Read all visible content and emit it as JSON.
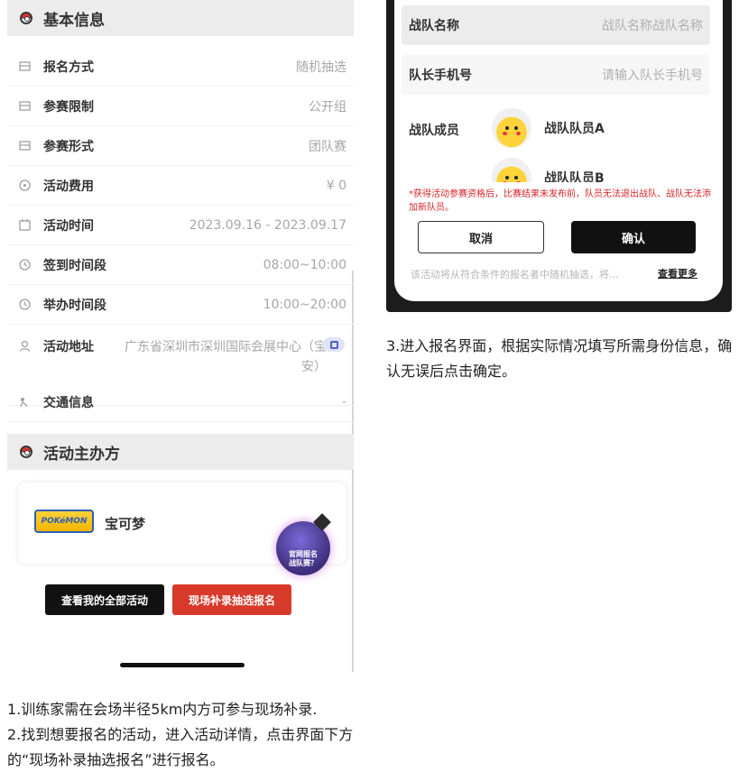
{
  "left_phone": {
    "basic_info": {
      "title": "基本信息",
      "rows": [
        {
          "label": "报名方式",
          "value": "随机抽选",
          "icon": "registration-icon"
        },
        {
          "label": "参赛限制",
          "value": "公开组",
          "icon": "limit-icon"
        },
        {
          "label": "参赛形式",
          "value": "团队赛",
          "icon": "format-icon"
        },
        {
          "label": "活动费用",
          "value": "¥ 0",
          "icon": "fee-icon"
        },
        {
          "label": "活动时间",
          "value": "2023.09.16 - 2023.09.17",
          "icon": "calendar-icon"
        },
        {
          "label": "签到时间段",
          "value": "08:00~10:00",
          "icon": "clock-icon"
        },
        {
          "label": "举办时间段",
          "value": "10:00~20:00",
          "icon": "clock-icon"
        },
        {
          "label": "活动地址",
          "value": "广东省深圳市深圳国际会展中心（宝安）",
          "icon": "location-icon"
        },
        {
          "label": "交通信息",
          "value": "-",
          "icon": "traffic-icon"
        }
      ]
    },
    "organizer": {
      "title": "活动主办方",
      "logo_text": "POKéMON",
      "name": "宝可梦"
    },
    "float_badge": {
      "line1": "官网报名",
      "line2": "战队赛？"
    },
    "buttons": {
      "my_activities": "查看我的全部活动",
      "onsite_register": "现场补录抽选报名"
    }
  },
  "right_phone": {
    "team_name": {
      "label": "战队名称",
      "value": "战队名称战队名称"
    },
    "leader_phone": {
      "label": "队长手机号",
      "placeholder": "请输入队长手机号"
    },
    "members": {
      "label": "战队成员",
      "items": [
        "战队队员A",
        "战队队员B"
      ]
    },
    "warning": "*获得活动参赛资格后，比赛结果未发布前，队员无法退出战队、战队无法添加新队员。",
    "cancel": "取消",
    "confirm": "确认",
    "footnote": "该活动将从符合条件的报名者中随机抽选，将...",
    "see_more": "查看更多"
  },
  "captions": {
    "step3": "3.进入报名界面，根据实际情况填写所需身份信息，确认无误后点击确定。",
    "step1": "1.训练家需在会场半径5km内方可参与现场补录.",
    "step2": "2.找到想要报名的活动，进入活动详情，点击界面下方的“现场补录抽选报名”进行报名。"
  },
  "colors": {
    "accent_red": "#d83a2a",
    "warning_red": "#d4262a",
    "dark": "#111111"
  }
}
